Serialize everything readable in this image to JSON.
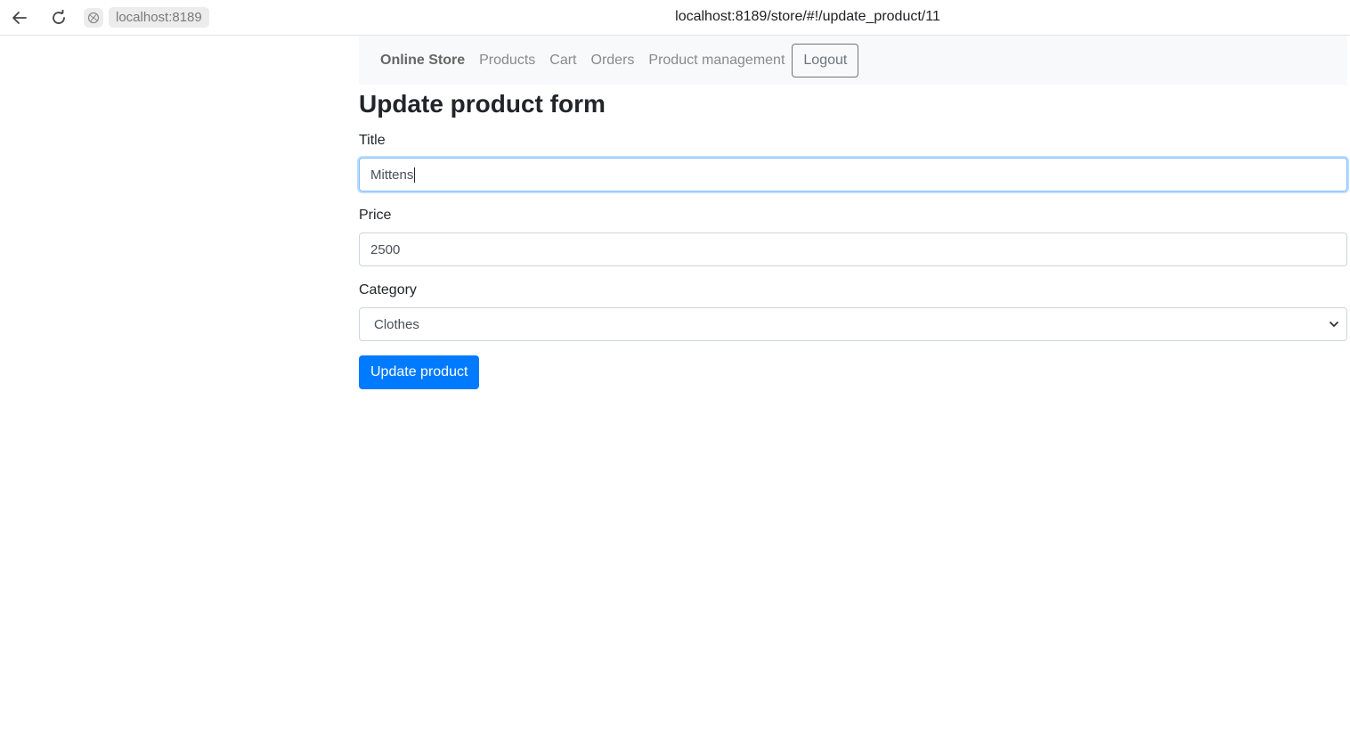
{
  "browser": {
    "host": "localhost:8189",
    "url": "localhost:8189/store/#!/update_product/11"
  },
  "navbar": {
    "brand": "Online Store",
    "links": [
      "Products",
      "Cart",
      "Orders",
      "Product management"
    ],
    "logout_label": "Logout"
  },
  "form": {
    "title": "Update product form",
    "fields": {
      "title": {
        "label": "Title",
        "value": "Mittens"
      },
      "price": {
        "label": "Price",
        "value": "2500"
      },
      "category": {
        "label": "Category",
        "selected": "Clothes"
      }
    },
    "submit_label": "Update product"
  },
  "colors": {
    "primary": "#007bff",
    "navbar_bg": "#f8f9fa",
    "focus_border": "#80bdff"
  }
}
